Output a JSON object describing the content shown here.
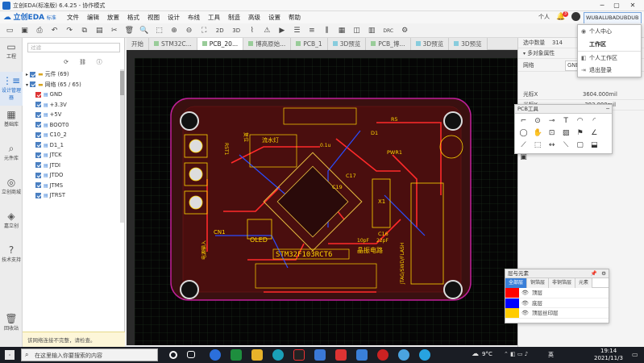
{
  "window": {
    "title": "立创EDA(标准版) 6.4.25 - 协作模式",
    "logo_text": "立创EDA",
    "logo_sub": "标准"
  },
  "menu": [
    "文件",
    "编辑",
    "放置",
    "格式",
    "视图",
    "设计",
    "布线",
    "工具",
    "制造",
    "高级",
    "设置",
    "帮助"
  ],
  "user": {
    "role": "个人",
    "notify_count": "3",
    "name": "WUBALUBADUBDUB"
  },
  "user_menu": [
    "个人中心",
    "工作区",
    "个人工作区",
    "退出登录"
  ],
  "toolbar_icons": [
    "save-icon",
    "save-all-icon",
    "undo-icon",
    "redo-icon",
    "copy-icon",
    "paste-icon",
    "cut-icon",
    "delete-icon",
    "search-icon",
    "zoom-in-icon",
    "zoom-out-icon",
    "fit-icon",
    "2D",
    "3D",
    "view-icon",
    "route-icon",
    "drc-icon",
    "align-icon",
    "layer-icon"
  ],
  "toolbar_text": {
    "v2d": "2D",
    "v3d": "3D",
    "drc": "DRC"
  },
  "leftnav": [
    {
      "label": "工程",
      "icon": "folder-icon"
    },
    {
      "label": "设计管理器",
      "icon": "tree-icon"
    },
    {
      "label": "基础库",
      "icon": "chip-icon"
    },
    {
      "label": "元件库",
      "icon": "search-lib-icon"
    },
    {
      "label": "立创商城",
      "icon": "lcsc-icon"
    },
    {
      "label": "嘉立创",
      "icon": "jlc-icon"
    },
    {
      "label": "技术支持",
      "icon": "help-icon"
    },
    {
      "label": "回收站",
      "icon": "trash-icon"
    }
  ],
  "panel": {
    "filter_placeholder": "过滤",
    "components_node": "元件 (69)",
    "nets_node": "网络 (65 / 65)",
    "nets": [
      "GND",
      "+3.3V",
      "+5V",
      "BOOT0",
      "C10_2",
      "D1_1",
      "JTCK",
      "JTDI",
      "JTDO",
      "JTMS",
      "JTRST"
    ],
    "hint": "该网络连接不完整，请检查。"
  },
  "tabs": [
    "开始",
    "STM32C...",
    "PCB_20...",
    "博高原始...",
    "PCB_1",
    "3D预览",
    "PCB_博...",
    "3D预览",
    "3D预览"
  ],
  "canvas_labels": {
    "mcu": "STM32F103RCT6",
    "oled": "OLED",
    "crystal": "晶振电路",
    "led": "流水灯",
    "power": "PWR1",
    "cn1": "CN1",
    "x1": "X1",
    "r5": "R5",
    "d1": "D1",
    "c17": "C17",
    "c19": "C19",
    "c16": "C16",
    "c15": "10pF",
    "c14": "22pF",
    "c_u": "0.1u",
    "jtag": "JTAG/SWD/FLASH",
    "rst": "RST1",
    "k1": "复位",
    "dc": "电源输入"
  },
  "right": {
    "selected_label": "选中数量",
    "selected_value": "314",
    "multi_label": "多对象属性",
    "net_label": "网络",
    "net_value": "GND",
    "cx_label": "光标X",
    "cx_value": "3604.000mil",
    "cy_label": "光标Y",
    "cy_value": "-293.000mil"
  },
  "pcb_tools": {
    "title": "PCB工具"
  },
  "layers": {
    "title": "层与元素",
    "tabs": [
      "全部层",
      "铜箔层",
      "非铜箔层",
      "元素"
    ],
    "rows": [
      {
        "name": "顶层",
        "color": "#ff0000"
      },
      {
        "name": "底层",
        "color": "#0000ff"
      },
      {
        "name": "顶层丝印层",
        "color": "#ffcc00"
      }
    ]
  },
  "taskbar": {
    "search_placeholder": "在这里输入你要搜索的内容",
    "weather": "9°C",
    "time": "19:14",
    "date": "2021/11/3",
    "lang": "英"
  }
}
